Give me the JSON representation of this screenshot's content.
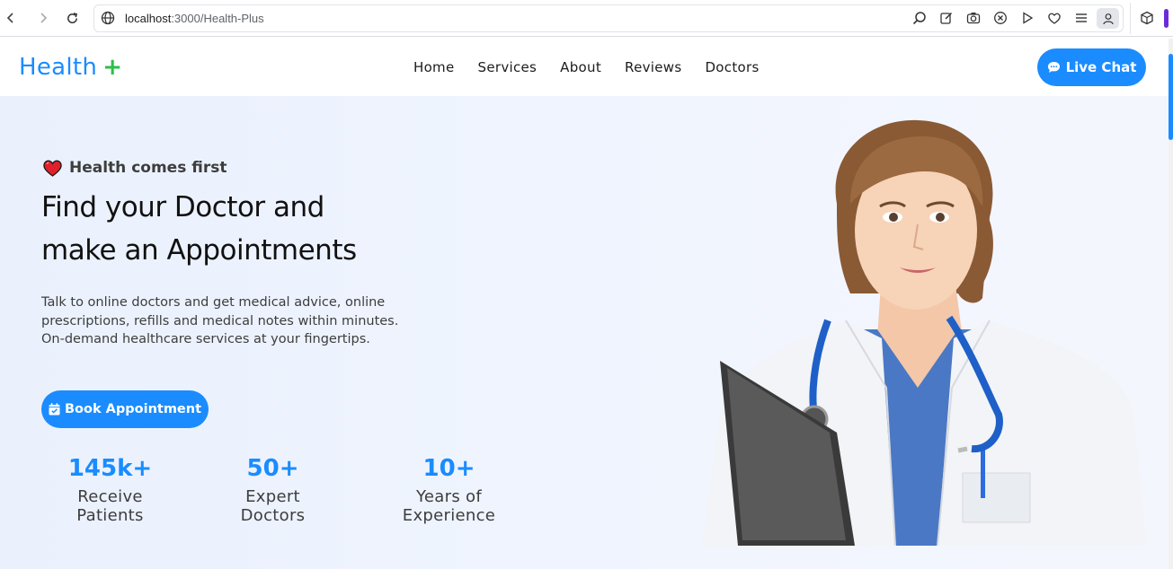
{
  "browser": {
    "url_host": "localhost",
    "url_path": ":3000/Health-Plus"
  },
  "header": {
    "logo_text": "Health",
    "logo_plus": "+",
    "nav": [
      "Home",
      "Services",
      "About",
      "Reviews",
      "Doctors"
    ],
    "live_chat_label": "Live Chat"
  },
  "hero": {
    "tagline": "Health comes first",
    "headline_line1": "Find your Doctor and",
    "headline_line2": "make an Appointments",
    "description": "Talk to online doctors and get medical advice, online prescriptions, refills and medical notes within minutes. On-demand healthcare services at your fingertips.",
    "book_label": "Book Appointment",
    "stats": [
      {
        "value": "145k+",
        "label": "Receive Patients"
      },
      {
        "value": "50+",
        "label": "Expert Doctors"
      },
      {
        "value": "10+",
        "label": "Years of Experience"
      }
    ]
  },
  "colors": {
    "accent": "#1a8cff",
    "plus_green": "#2bbf4a",
    "heart_red": "#e0202a"
  },
  "icons": [
    "back-icon",
    "forward-icon",
    "reload-icon",
    "globe-icon",
    "search-icon",
    "edit-icon",
    "camera-icon",
    "shield-icon",
    "play-icon",
    "heart-icon",
    "menu-icon",
    "profile-icon",
    "extension-icon",
    "chat-icon",
    "calendar-icon"
  ]
}
